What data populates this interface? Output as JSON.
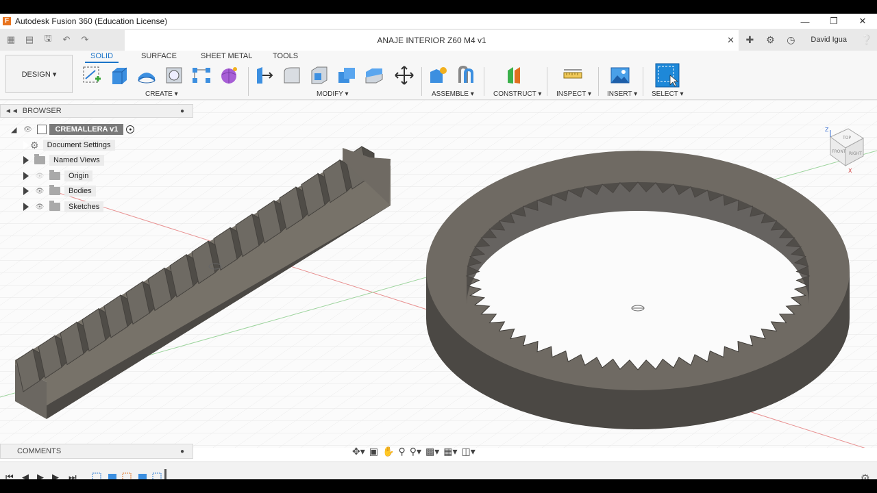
{
  "window": {
    "title": "Autodesk Fusion 360 (Education License)",
    "minimize_icon": "minimize-icon",
    "maximize_icon": "maximize-icon",
    "close_icon": "close-icon"
  },
  "document": {
    "tab_title": "ANAJE INTERIOR Z60 M4 v1",
    "user": "David Igua"
  },
  "workspace": {
    "selector_label": "DESIGN ▾"
  },
  "ribbon": {
    "tabs": [
      {
        "label": "SOLID",
        "active": true
      },
      {
        "label": "SURFACE",
        "active": false
      },
      {
        "label": "SHEET METAL",
        "active": false
      },
      {
        "label": "TOOLS",
        "active": false
      }
    ],
    "groups": {
      "create": "CREATE ▾",
      "modify": "MODIFY ▾",
      "assemble": "ASSEMBLE ▾",
      "construct": "CONSTRUCT ▾",
      "inspect": "INSPECT ▾",
      "insert": "INSERT ▾",
      "select": "SELECT ▾"
    }
  },
  "browser": {
    "title": "BROWSER",
    "root": "CREMALLERA v1",
    "items": [
      {
        "label": "Document Settings"
      },
      {
        "label": "Named Views"
      },
      {
        "label": "Origin"
      },
      {
        "label": "Bodies"
      },
      {
        "label": "Sketches"
      }
    ]
  },
  "comments": {
    "title": "COMMENTS"
  },
  "viewcube": {
    "axis_z": "Z",
    "axis_x": "X",
    "face_top": "TOP",
    "face_front": "FRONT",
    "face_right": "RIGHT"
  },
  "colors": {
    "accent": "#1a73c8",
    "model": "#6e6a63",
    "model_dark": "#4d4a45"
  }
}
